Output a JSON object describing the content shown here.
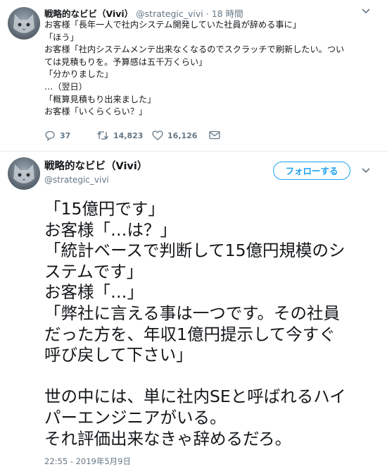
{
  "tweet1": {
    "display_name": "戦略的なビビ（Vivi）",
    "handle": "@strategic_vivi",
    "time_sep": "·",
    "time": "18 時間",
    "lines": [
      "お客様「長年一人で社内システム開発していた社員が辞める事に」",
      "「ほう」",
      "お客様「社内システムメンテ出来なくなるのでスクラッチで刷新したい。つい",
      "ては見積もりを。予算感は五千万くらい」",
      "「分かりました」",
      "…（翌日）",
      "「概算見積もり出来ました」",
      "お客様「いくらくらい？」"
    ],
    "actions": {
      "replies": "37",
      "retweets": "14,823",
      "likes": "16,126"
    }
  },
  "tweet2": {
    "display_name": "戦略的なビビ（Vivi）",
    "handle": "@strategic_vivi",
    "follow_label": "フォローする",
    "lines": [
      "「15億円です」",
      "お客様「…は？」",
      "「統計ベースで判断して15億円規模のシ",
      "ステムです」",
      "お客様「…」",
      "「弊社に言える事は一つです。その社員",
      "だった方を、年収1億円提示して今すぐ",
      "呼び戻して下さい」",
      "",
      "世の中には、単に社内SEと呼ばれるハイ",
      "パーエンジニアがいる。",
      "それ評価出来なきゃ辞めるだろ。"
    ],
    "timestamp": "22:55 - 2019年5月9日"
  },
  "icons": {
    "caret": "chevron-down-icon",
    "reply": "reply-icon",
    "retweet": "retweet-icon",
    "like": "heart-icon",
    "dm": "envelope-icon",
    "avatar": "cat-avatar"
  },
  "colors": {
    "text": "#14171a",
    "secondary": "#657786",
    "accent": "#1da1f2",
    "divider": "#e6ecf0"
  }
}
